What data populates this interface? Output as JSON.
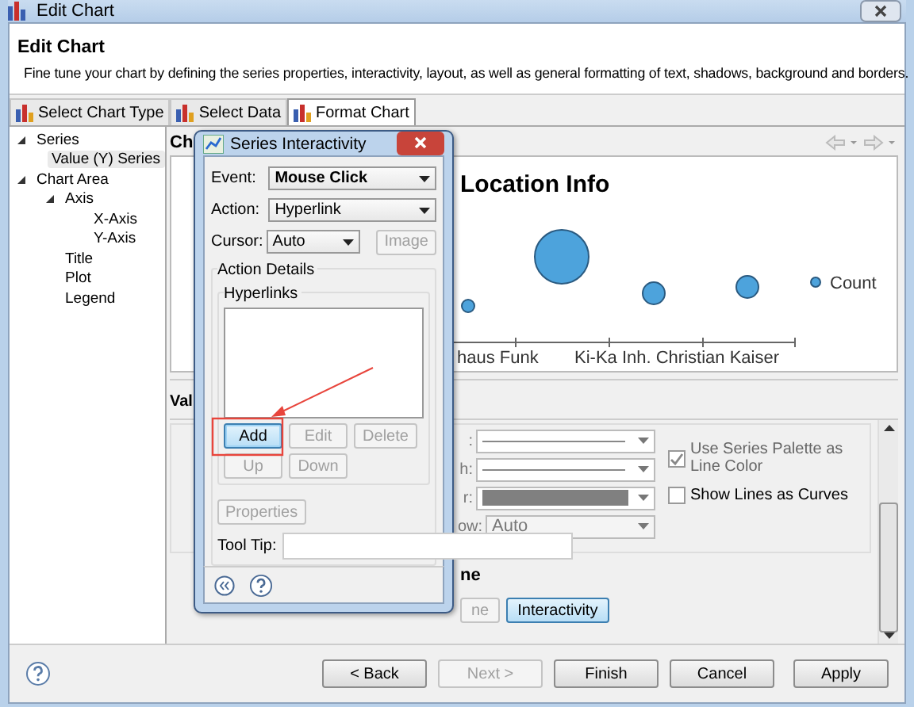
{
  "window": {
    "title": "Edit Chart"
  },
  "header": {
    "title": "Edit Chart",
    "description": "Fine tune your chart by defining the series properties, interactivity, layout, as well as general formatting of text, shadows, background and borders."
  },
  "tabs": [
    {
      "label": "Select Chart Type",
      "selected": false
    },
    {
      "label": "Select Data",
      "selected": false
    },
    {
      "label": "Format Chart",
      "selected": true
    }
  ],
  "tree": [
    {
      "label": "Series",
      "expanded": true,
      "selected": false,
      "children": [
        {
          "label": "Value (Y) Series",
          "selected": true
        }
      ]
    },
    {
      "label": "Chart Area",
      "expanded": true,
      "selected": false,
      "children": [
        {
          "label": "Axis",
          "expanded": true,
          "selected": false,
          "children": [
            {
              "label": "X-Axis",
              "selected": false
            },
            {
              "label": "Y-Axis",
              "selected": false
            }
          ]
        },
        {
          "label": "Title",
          "selected": false
        },
        {
          "label": "Plot",
          "selected": false
        },
        {
          "label": "Legend",
          "selected": false
        }
      ]
    }
  ],
  "chart_section": {
    "heading": "Ch",
    "chart": {
      "title": "Location Info",
      "x_labels": [
        "haus Funk",
        "Ki-Ka Inh. Christian Kaiser"
      ],
      "legend": "Count"
    }
  },
  "value_section": {
    "heading": "Val",
    "fields": [
      {
        "label": ":",
        "kind": "line"
      },
      {
        "label": "h:",
        "kind": "line"
      },
      {
        "label": "r:",
        "kind": "color"
      },
      {
        "label": "ow:",
        "kind": "text",
        "value": "Auto"
      }
    ],
    "checkboxes": [
      {
        "label": "Use Series Palette as Line Color",
        "checked": true,
        "disabled": true
      },
      {
        "label": "Show Lines as Curves",
        "checked": false,
        "disabled": false
      }
    ],
    "subheading": "ne",
    "buttons": [
      {
        "label": "ne",
        "selected": false,
        "disabled": true
      },
      {
        "label": "Interactivity",
        "selected": true,
        "disabled": false
      }
    ]
  },
  "dialog": {
    "title": "Series Interactivity",
    "fields": [
      {
        "label": "Event:",
        "value": "Mouse Click",
        "focused": true,
        "kind": "wide"
      },
      {
        "label": "Action:",
        "value": "Hyperlink",
        "focused": false,
        "kind": "wide"
      },
      {
        "label": "Cursor:",
        "value": "Auto",
        "focused": false,
        "kind": "narrow"
      }
    ],
    "image_button": {
      "label": "Image",
      "disabled": true
    },
    "group": "Action Details",
    "subgroup": "Hyperlinks",
    "list_buttons": [
      {
        "label": "Add",
        "disabled": false,
        "focused": true
      },
      {
        "label": "Edit",
        "disabled": true,
        "focused": false
      },
      {
        "label": "Delete",
        "disabled": true,
        "focused": false
      },
      {
        "label": "Up",
        "disabled": true,
        "focused": false
      },
      {
        "label": "Down",
        "disabled": true,
        "focused": false
      }
    ],
    "properties_button": {
      "label": "Properties",
      "disabled": true
    },
    "tooltip_label": "Tool Tip:"
  },
  "footer": {
    "buttons": [
      {
        "label": "< Back",
        "disabled": false
      },
      {
        "label": "Next >",
        "disabled": true
      },
      {
        "label": "Finish",
        "disabled": false
      },
      {
        "label": "Cancel",
        "disabled": false
      },
      {
        "label": "Apply",
        "disabled": false
      }
    ]
  }
}
